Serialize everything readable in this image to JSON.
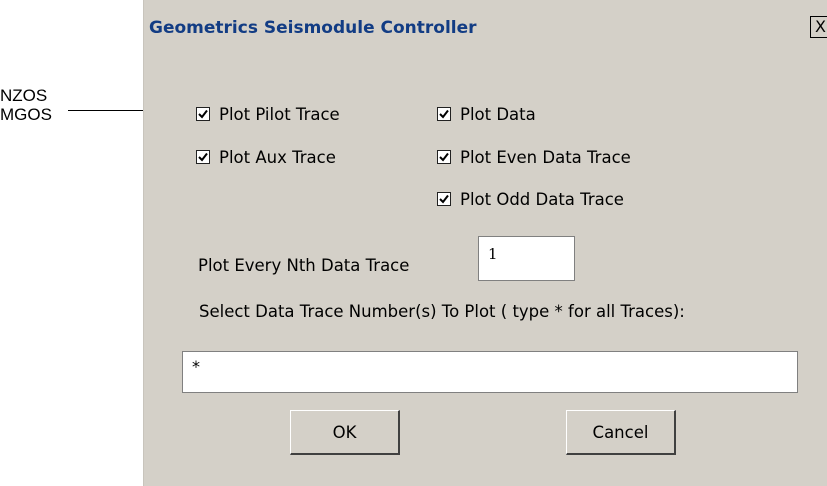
{
  "annotation": {
    "line1": "NZOS",
    "line2": "MGOS",
    "arrow_icon": "arrow-right-icon"
  },
  "window": {
    "title": "Geometrics Seismodule Controller",
    "close_label": "X"
  },
  "checkboxes": {
    "plot_pilot_trace": {
      "label": "Plot Pilot Trace",
      "checked": true
    },
    "plot_aux_trace": {
      "label": "Plot Aux Trace",
      "checked": true
    },
    "plot_data": {
      "label": "Plot Data",
      "checked": true
    },
    "plot_even_data_trace": {
      "label": "Plot Even Data Trace",
      "checked": true
    },
    "plot_odd_data_trace": {
      "label": "Plot Odd Data Trace",
      "checked": true
    }
  },
  "nth_trace": {
    "label": "Plot Every Nth Data Trace",
    "value": "1"
  },
  "trace_select": {
    "label": "Select Data Trace Number(s) To Plot  ( type * for all Traces):",
    "value": "*"
  },
  "buttons": {
    "ok": "OK",
    "cancel": "Cancel"
  },
  "colors": {
    "dialog_face": "#d4d0c8",
    "title_text": "#123c84"
  }
}
